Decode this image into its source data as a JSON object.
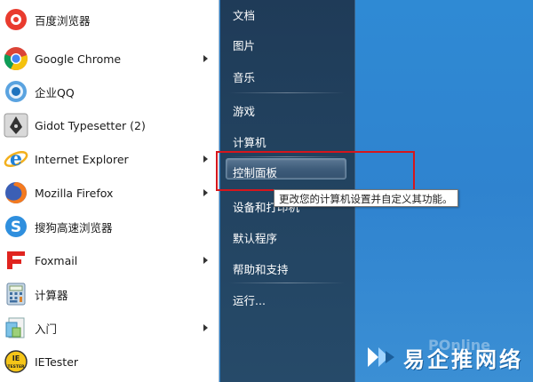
{
  "programs": [
    {
      "label": "百度浏览器",
      "icon": "baidu-browser-icon",
      "arrow": false
    },
    {
      "label": "Google Chrome",
      "icon": "chrome-icon",
      "arrow": true
    },
    {
      "label": "企业QQ",
      "icon": "qq-icon",
      "arrow": false
    },
    {
      "label": "Gidot Typesetter (2)",
      "icon": "pen-nib-icon",
      "arrow": false
    },
    {
      "label": "Internet Explorer",
      "icon": "internet-explorer-icon",
      "arrow": true
    },
    {
      "label": "Mozilla Firefox",
      "icon": "firefox-icon",
      "arrow": true
    },
    {
      "label": "搜狗高速浏览器",
      "icon": "sogou-browser-icon",
      "arrow": false
    },
    {
      "label": "Foxmail",
      "icon": "foxmail-icon",
      "arrow": true
    },
    {
      "label": "计算器",
      "icon": "calculator-icon",
      "arrow": false
    },
    {
      "label": "入门",
      "icon": "getting-started-icon",
      "arrow": true
    },
    {
      "label": "IETester",
      "icon": "ietester-icon",
      "arrow": false
    }
  ],
  "places": {
    "documents": "文档",
    "pictures": "图片",
    "music": "音乐",
    "games": "游戏",
    "computer": "计算机",
    "control_panel": "控制面板",
    "devices_printers": "设备和打印机",
    "default_programs": "默认程序",
    "help_support": "帮助和支持",
    "run": "运行..."
  },
  "tooltip": "更改您的计算机设置并自定义其功能。",
  "watermark": {
    "text": "易企推网络",
    "ghost": "POnline"
  },
  "colors": {
    "highlight_box": "#d6161c",
    "right_panel": "#22425f",
    "desktop": "#2f8ad4"
  }
}
